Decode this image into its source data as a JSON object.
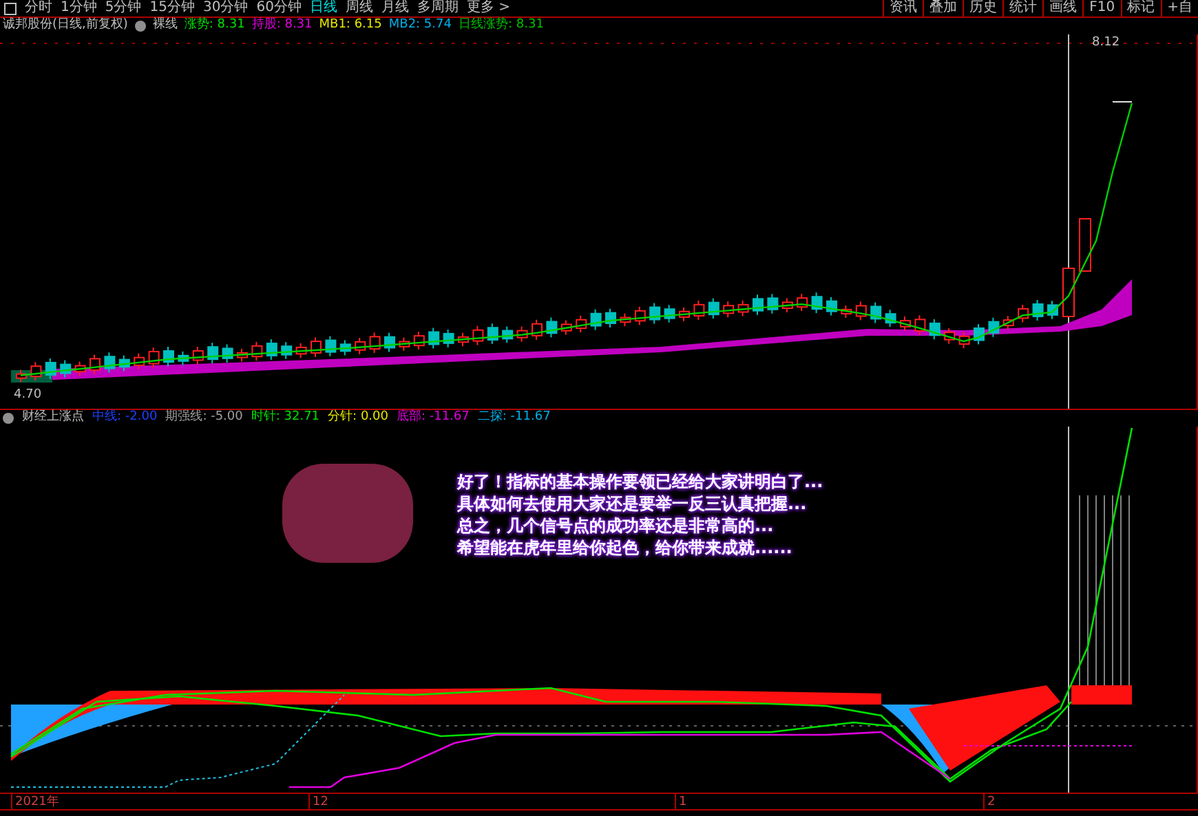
{
  "toolbar": {
    "periods": [
      {
        "label": "分时",
        "selected": false
      },
      {
        "label": "1分钟",
        "selected": false
      },
      {
        "label": "5分钟",
        "selected": false
      },
      {
        "label": "15分钟",
        "selected": false
      },
      {
        "label": "30分钟",
        "selected": false
      },
      {
        "label": "60分钟",
        "selected": false
      },
      {
        "label": "日线",
        "selected": true
      },
      {
        "label": "周线",
        "selected": false
      },
      {
        "label": "月线",
        "selected": false
      },
      {
        "label": "多周期",
        "selected": false
      },
      {
        "label": "更多 >",
        "selected": false
      }
    ],
    "actions": [
      "资讯",
      "叠加",
      "历史",
      "统计",
      "画线",
      "F10",
      "标记",
      "+自"
    ]
  },
  "main_chart": {
    "title": "诚邦股份(日线,前复权)",
    "mode": "裸线",
    "legend": [
      {
        "text": "涨势: 8.31",
        "color": "#00e000"
      },
      {
        "text": "持股: 8.31",
        "color": "#e000e0"
      },
      {
        "text": "MB1: 6.15",
        "color": "#e8e800"
      },
      {
        "text": "MB2: 5.74",
        "color": "#00b0e8"
      },
      {
        "text": "日线涨势: 8.31",
        "color": "#00c000"
      }
    ],
    "high_label": "8.12",
    "low_label": "4.70"
  },
  "indicator_panel": {
    "title": "财经上涨点",
    "legend": [
      {
        "text": "中线: -2.00",
        "color": "#2040ff"
      },
      {
        "text": "期强线: -5.00",
        "color": "#a0a0a0"
      },
      {
        "text": "时针: 32.71",
        "color": "#00e000"
      },
      {
        "text": "分针: 0.00",
        "color": "#e8e800"
      },
      {
        "text": "底部: -11.67",
        "color": "#e000e0"
      },
      {
        "text": "二探: -11.67",
        "color": "#00b0e8"
      }
    ],
    "note_lines": [
      "好了！指标的基本操作要领已经给大家讲明白了...",
      "具体如何去使用大家还是要举一反三认真把握...",
      "总之，几个信号点的成功率还是非常高的...",
      "希望能在虎年里给你起色，给你带来成就......"
    ]
  },
  "time_axis": [
    "2021年",
    "12",
    "1",
    "2"
  ]
}
